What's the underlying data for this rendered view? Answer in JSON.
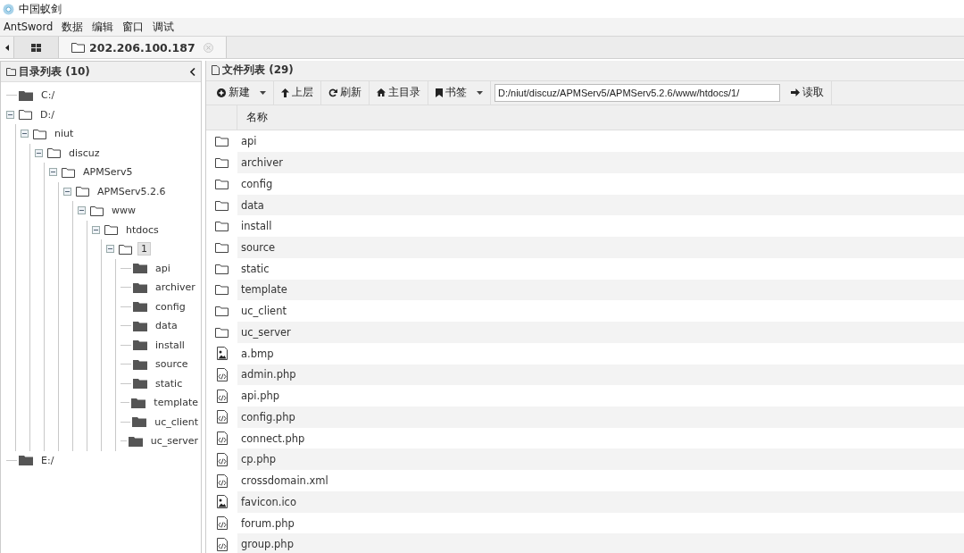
{
  "window": {
    "title": "中国蚁剑"
  },
  "menu": [
    "AntSword",
    "数据",
    "编辑",
    "窗口",
    "调试"
  ],
  "tabs": [
    {
      "kind": "home",
      "selected": false
    },
    {
      "kind": "shell",
      "label": "202.206.100.187",
      "selected": true
    }
  ],
  "directory_panel": {
    "title": "目录列表 (10)",
    "tree": [
      {
        "label": "C:/",
        "expanded": false,
        "selected": false
      },
      {
        "label": "D:/",
        "expanded": true,
        "selected": false,
        "children": [
          {
            "label": "niut",
            "expanded": true,
            "selected": false,
            "children": [
              {
                "label": "discuz",
                "expanded": true,
                "selected": false,
                "children": [
                  {
                    "label": "APMServ5",
                    "expanded": true,
                    "selected": false,
                    "children": [
                      {
                        "label": "APMServ5.2.6",
                        "expanded": true,
                        "selected": false,
                        "children": [
                          {
                            "label": "www",
                            "expanded": true,
                            "selected": false,
                            "children": [
                              {
                                "label": "htdocs",
                                "expanded": true,
                                "selected": false,
                                "children": [
                                  {
                                    "label": "1",
                                    "expanded": true,
                                    "selected": true,
                                    "children": [
                                      {
                                        "label": "api",
                                        "expanded": false,
                                        "selected": false
                                      },
                                      {
                                        "label": "archiver",
                                        "expanded": false,
                                        "selected": false
                                      },
                                      {
                                        "label": "config",
                                        "expanded": false,
                                        "selected": false
                                      },
                                      {
                                        "label": "data",
                                        "expanded": false,
                                        "selected": false
                                      },
                                      {
                                        "label": "install",
                                        "expanded": false,
                                        "selected": false
                                      },
                                      {
                                        "label": "source",
                                        "expanded": false,
                                        "selected": false
                                      },
                                      {
                                        "label": "static",
                                        "expanded": false,
                                        "selected": false
                                      },
                                      {
                                        "label": "template",
                                        "expanded": false,
                                        "selected": false
                                      },
                                      {
                                        "label": "uc_client",
                                        "expanded": false,
                                        "selected": false
                                      },
                                      {
                                        "label": "uc_server",
                                        "expanded": false,
                                        "selected": false
                                      }
                                    ]
                                  }
                                ]
                              }
                            ]
                          }
                        ]
                      }
                    ]
                  }
                ]
              }
            ]
          }
        ]
      },
      {
        "label": "E:/",
        "expanded": false,
        "selected": false
      }
    ]
  },
  "file_panel": {
    "title": "文件列表 (29)",
    "toolbar": [
      {
        "kind": "new",
        "label": "新建",
        "dropdown": true
      },
      {
        "kind": "up",
        "label": "上层",
        "dropdown": false
      },
      {
        "kind": "refresh",
        "label": "刷新",
        "dropdown": false
      },
      {
        "kind": "home",
        "label": "主目录",
        "dropdown": false
      },
      {
        "kind": "bookmark",
        "label": "书签",
        "dropdown": true
      }
    ],
    "path": "D:/niut/discuz/APMServ5/APMServ5.2.6/www/htdocs/1/",
    "read_button": "读取",
    "columns": [
      "名称"
    ],
    "rows": [
      {
        "kind": "folder",
        "name": "api"
      },
      {
        "kind": "folder",
        "name": "archiver"
      },
      {
        "kind": "folder",
        "name": "config"
      },
      {
        "kind": "folder",
        "name": "data"
      },
      {
        "kind": "folder",
        "name": "install"
      },
      {
        "kind": "folder",
        "name": "source"
      },
      {
        "kind": "folder",
        "name": "static"
      },
      {
        "kind": "folder",
        "name": "template"
      },
      {
        "kind": "folder",
        "name": "uc_client"
      },
      {
        "kind": "folder",
        "name": "uc_server"
      },
      {
        "kind": "image",
        "name": "a.bmp"
      },
      {
        "kind": "code",
        "name": "admin.php"
      },
      {
        "kind": "code",
        "name": "api.php"
      },
      {
        "kind": "code",
        "name": "config.php"
      },
      {
        "kind": "code",
        "name": "connect.php"
      },
      {
        "kind": "code",
        "name": "cp.php"
      },
      {
        "kind": "code",
        "name": "crossdomain.xml"
      },
      {
        "kind": "image",
        "name": "favicon.ico"
      },
      {
        "kind": "code",
        "name": "forum.php"
      },
      {
        "kind": "code",
        "name": "group.php"
      }
    ]
  }
}
